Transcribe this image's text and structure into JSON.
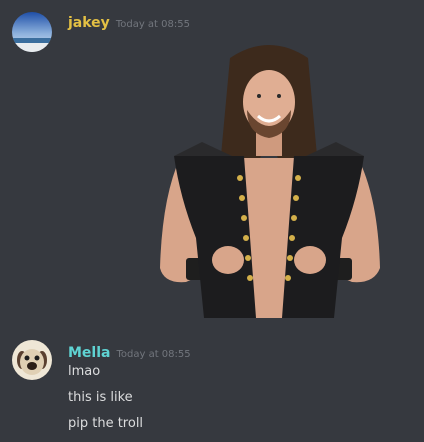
{
  "colors": {
    "background": "#36393f",
    "jakey_name": "#e3c044",
    "mella_name": "#5fd3d3",
    "timestamp": "#72767d",
    "text": "#dcddde"
  },
  "messages": [
    {
      "author": "jakey",
      "timestamp": "Today at 08:55",
      "avatar_icon": "ocean-horizon-avatar",
      "attachment": "image-of-long-haired-wrestler-in-studded-black-vest"
    },
    {
      "author": "Mella",
      "timestamp": "Today at 08:55",
      "avatar_icon": "cartoon-dog-avatar",
      "lines": [
        "lmao",
        "this is like",
        "pip the troll"
      ]
    }
  ]
}
